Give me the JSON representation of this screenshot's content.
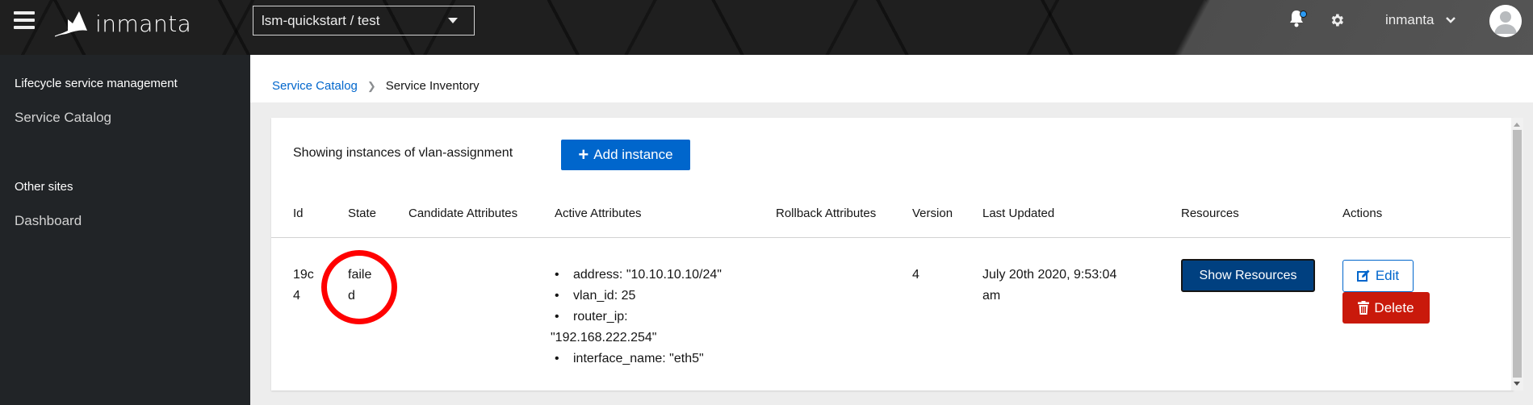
{
  "header": {
    "menu_icon": "hamburger-icon",
    "logo_text": "inmanta",
    "environment_selector": "lsm-quickstart / test",
    "notification_icon": "bell-icon",
    "settings_icon": "gear-icon",
    "user_name": "inmanta",
    "avatar_icon": "user-avatar-icon",
    "colors": {
      "notification_dot": "#2b9af3"
    }
  },
  "sidebar": {
    "sections": [
      {
        "title": "Lifecycle service management",
        "items": [
          {
            "label": "Service Catalog"
          }
        ]
      },
      {
        "title": "Other sites",
        "items": [
          {
            "label": "Dashboard"
          }
        ]
      }
    ]
  },
  "breadcrumb": {
    "items": [
      {
        "label": "Service Catalog",
        "link": true
      },
      {
        "label": "Service Inventory",
        "link": false
      }
    ],
    "separator_icon": "chevron-right-icon"
  },
  "main": {
    "toolbar_text": "Showing instances of vlan-assignment",
    "add_button": {
      "label": "Add instance",
      "icon": "plus-icon",
      "color": "#0066cc"
    },
    "table": {
      "columns": [
        "Id",
        "State",
        "Candidate Attributes",
        "Active Attributes",
        "Rollback Attributes",
        "Version",
        "Last Updated",
        "Resources",
        "Actions"
      ],
      "rows": [
        {
          "id_line1": "19c",
          "id_line2": "4",
          "state_line1": "faile",
          "state_line2": "d",
          "candidate_attributes": "",
          "active_attributes": [
            "address: \"10.10.10.10/24\"",
            "vlan_id: 25",
            "router_ip:",
            "\"192.168.222.254\"",
            "interface_name: \"eth5\""
          ],
          "rollback_attributes": "",
          "version": "4",
          "last_updated_line1": "July 20th 2020, 9:53:04",
          "last_updated_line2": "am",
          "resources_button": "Show Resources",
          "edit_button": "Edit",
          "delete_button": "Delete"
        }
      ]
    },
    "colors": {
      "show_resources": "#004080",
      "edit": "#0066cc",
      "delete": "#c9190b",
      "annotation_circle": "#ff0000"
    }
  }
}
